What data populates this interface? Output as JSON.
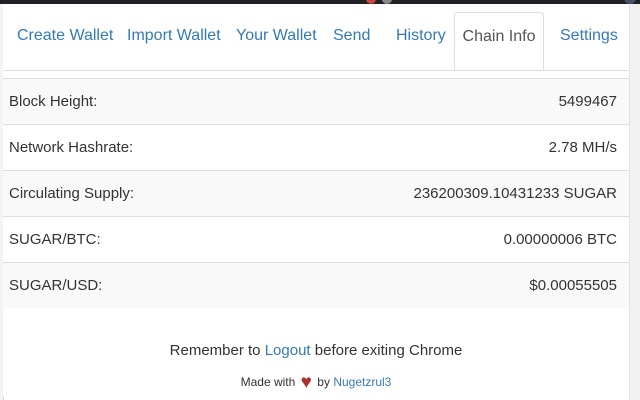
{
  "tabs": [
    {
      "label": "Create Wallet",
      "active": false
    },
    {
      "label": "Import Wallet",
      "active": false
    },
    {
      "label": "Your Wallet",
      "active": false
    },
    {
      "label": "Send",
      "active": false
    },
    {
      "label": "History",
      "active": false
    },
    {
      "label": "Chain Info",
      "active": true
    },
    {
      "label": "Settings",
      "active": false
    }
  ],
  "chain_info": [
    {
      "label": "Block Height:",
      "value": "5499467"
    },
    {
      "label": "Network Hashrate:",
      "value": "2.78 MH/s"
    },
    {
      "label": "Circulating Supply:",
      "value": "236200309.10431233 SUGAR"
    },
    {
      "label": "SUGAR/BTC:",
      "value": "0.00000006 BTC"
    },
    {
      "label": "SUGAR/USD:",
      "value": "$0.00055505"
    }
  ],
  "footer": {
    "reminder_prefix": "Remember to ",
    "logout_link": "Logout",
    "reminder_suffix": " before exiting Chrome",
    "made_with": "Made with",
    "heart": "♥",
    "by": "by",
    "author_link": "Nugetzrul3"
  },
  "colors": {
    "link": "#337ab7",
    "heart": "#a83232",
    "active_tab_text": "#555555",
    "stripe": "#f9f9f9"
  }
}
